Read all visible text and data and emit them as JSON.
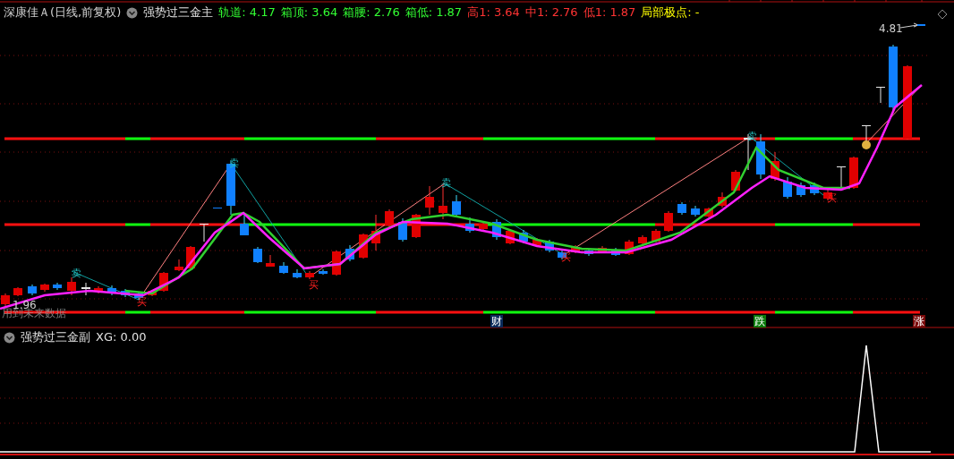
{
  "header": {
    "stock": "深康佳Ａ(日线,前复权)",
    "indicator": "强势过三金主",
    "values": [
      {
        "text": "轨道: 4.17",
        "color": "#33ff33"
      },
      {
        "text": "箱顶: 3.64",
        "color": "#33ff33"
      },
      {
        "text": "箱腰: 2.76",
        "color": "#33ff33"
      },
      {
        "text": "箱低: 1.87",
        "color": "#33ff33"
      },
      {
        "text": "高1: 3.64",
        "color": "#ff3333"
      },
      {
        "text": "中1: 2.76",
        "color": "#ff3333"
      },
      {
        "text": "低1: 1.87",
        "color": "#ff3333"
      },
      {
        "text": "局部极点: -",
        "color": "#ffff00"
      }
    ]
  },
  "main_chart": {
    "high_label": "4.81",
    "low_label": "1.96",
    "warning": "用到未来数据",
    "signals": [
      {
        "kind": "sell",
        "label": "卖"
      },
      {
        "kind": "buy",
        "label": "买"
      },
      {
        "kind": "sell",
        "label": "卖"
      },
      {
        "kind": "buy",
        "label": "买"
      },
      {
        "kind": "sell",
        "label": "卖"
      },
      {
        "kind": "buy",
        "label": "买"
      },
      {
        "kind": "sell",
        "label": "卖"
      },
      {
        "kind": "buy",
        "label": "买"
      }
    ],
    "tags": [
      {
        "label": "财",
        "color": "#0a2a5a"
      },
      {
        "label": "跌",
        "color": "#0a7a0a"
      },
      {
        "label": "涨",
        "color": "#7a0a0a"
      }
    ]
  },
  "sub_chart": {
    "indicator": "强势过三金副",
    "reading": "XG: 0.00"
  }
}
